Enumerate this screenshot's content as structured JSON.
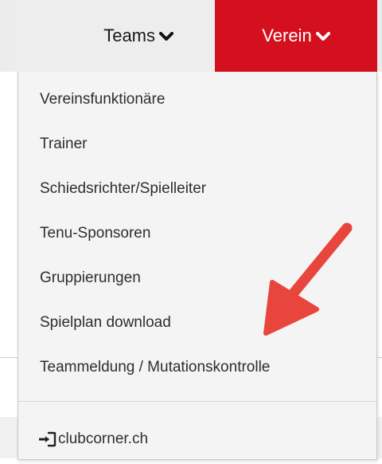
{
  "nav": {
    "teams_label": "Teams",
    "verein_label": "Verein",
    "accent_color": "#d5101e"
  },
  "menu": {
    "items": [
      {
        "label": "Vereinsfunktionäre"
      },
      {
        "label": "Trainer"
      },
      {
        "label": "Schiedsrichter/Spielleiter"
      },
      {
        "label": "Tenu-Sponsoren"
      },
      {
        "label": "Gruppierungen"
      },
      {
        "label": "Spielplan download"
      },
      {
        "label": "Teammeldung / Mutationskontrolle"
      }
    ],
    "footer_label": "clubcorner.ch",
    "footer_icon": "sign-in-icon"
  },
  "annotation": {
    "icon": "red-arrow-icon",
    "color": "#e8453c"
  }
}
